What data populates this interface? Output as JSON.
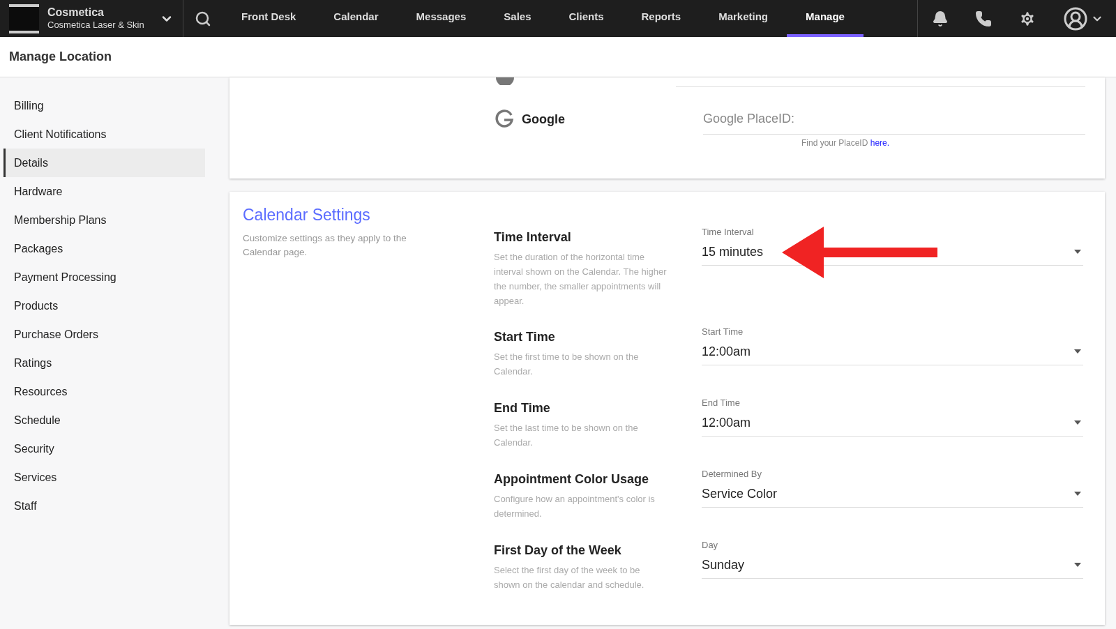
{
  "brand": {
    "name": "Cosmetica",
    "location": "Cosmetica Laser & Skin"
  },
  "nav": [
    {
      "label": "Front Desk",
      "selected": false
    },
    {
      "label": "Calendar",
      "selected": false
    },
    {
      "label": "Messages",
      "selected": false
    },
    {
      "label": "Sales",
      "selected": false
    },
    {
      "label": "Clients",
      "selected": false
    },
    {
      "label": "Reports",
      "selected": false
    },
    {
      "label": "Marketing",
      "selected": false
    },
    {
      "label": "Manage",
      "selected": true
    }
  ],
  "page_title": "Manage Location",
  "sidebar": {
    "items": [
      {
        "label": "Billing",
        "selected": false
      },
      {
        "label": "Client Notifications",
        "selected": false
      },
      {
        "label": "Details",
        "selected": true
      },
      {
        "label": "Hardware",
        "selected": false
      },
      {
        "label": "Membership Plans",
        "selected": false
      },
      {
        "label": "Packages",
        "selected": false
      },
      {
        "label": "Payment Processing",
        "selected": false
      },
      {
        "label": "Products",
        "selected": false
      },
      {
        "label": "Purchase Orders",
        "selected": false
      },
      {
        "label": "Ratings",
        "selected": false
      },
      {
        "label": "Resources",
        "selected": false
      },
      {
        "label": "Schedule",
        "selected": false
      },
      {
        "label": "Security",
        "selected": false
      },
      {
        "label": "Services",
        "selected": false
      },
      {
        "label": "Staff",
        "selected": false
      }
    ]
  },
  "social": {
    "google": {
      "label": "Google",
      "placeholder": "Google PlaceID:",
      "hint": "Find your PlaceID",
      "link": "here."
    }
  },
  "calendar_settings": {
    "title": "Calendar Settings",
    "description": "Customize settings as they apply to the Calendar page.",
    "rows": [
      {
        "title": "Time Interval",
        "description": "Set the duration of the horizontal time interval shown on the Calendar. The higher the number, the smaller appointments will appear.",
        "field_label": "Time Interval",
        "value": "15 minutes",
        "annotated": true
      },
      {
        "title": "Start Time",
        "description": "Set the first time to be shown on the Calendar.",
        "field_label": "Start Time",
        "value": "12:00am",
        "annotated": false
      },
      {
        "title": "End Time",
        "description": "Set the last time to be shown on the Calendar.",
        "field_label": "End Time",
        "value": "12:00am",
        "annotated": false
      },
      {
        "title": "Appointment Color Usage",
        "description": "Configure how an appointment's color is determined.",
        "field_label": "Determined By",
        "value": "Service Color",
        "annotated": false
      },
      {
        "title": "First Day of the Week",
        "description": "Select the first day of the week to be shown on the calendar and schedule.",
        "field_label": "Day",
        "value": "Sunday",
        "annotated": false
      }
    ]
  }
}
